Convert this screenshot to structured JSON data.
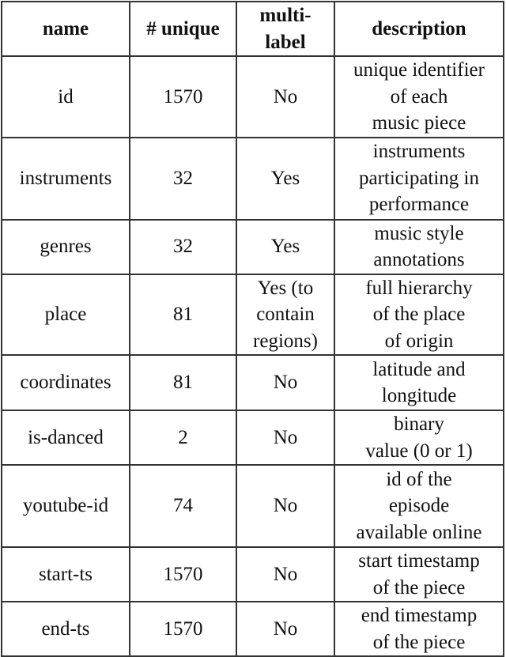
{
  "table": {
    "headers": [
      {
        "lines": [
          "name"
        ]
      },
      {
        "lines": [
          "# unique"
        ]
      },
      {
        "lines": [
          "multi-",
          "label"
        ]
      },
      {
        "lines": [
          "description"
        ]
      }
    ],
    "rows": [
      {
        "key": "id",
        "name": "id",
        "unique": "1570",
        "multilabel": [
          "No"
        ],
        "description": [
          "unique identifier",
          "of each",
          "music piece"
        ]
      },
      {
        "key": "instruments",
        "name": "instruments",
        "unique": "32",
        "multilabel": [
          "Yes"
        ],
        "description": [
          "instruments",
          "participating in",
          "performance"
        ]
      },
      {
        "key": "genres",
        "name": "genres",
        "unique": "32",
        "multilabel": [
          "Yes"
        ],
        "description": [
          "music style",
          "annotations"
        ]
      },
      {
        "key": "place",
        "name": "place",
        "unique": "81",
        "multilabel": [
          "Yes (to",
          "contain",
          "regions)"
        ],
        "description": [
          "full hierarchy",
          "of the place",
          "of origin"
        ]
      },
      {
        "key": "coordinates",
        "name": "coordinates",
        "unique": "81",
        "multilabel": [
          "No"
        ],
        "description": [
          "latitude and",
          "longitude"
        ]
      },
      {
        "key": "is-danced",
        "name": "is-danced",
        "unique": "2",
        "multilabel": [
          "No"
        ],
        "description": [
          "binary",
          "value (0 or 1)"
        ]
      },
      {
        "key": "youtube-id",
        "name": "youtube-id",
        "unique": "74",
        "multilabel": [
          "No"
        ],
        "description": [
          "id of the",
          "episode",
          "available online"
        ]
      },
      {
        "key": "start-ts",
        "name": "start-ts",
        "unique": "1570",
        "multilabel": [
          "No"
        ],
        "description": [
          "start timestamp",
          "of the piece"
        ]
      },
      {
        "key": "end-ts",
        "name": "end-ts",
        "unique": "1570",
        "multilabel": [
          "No"
        ],
        "description": [
          "end timestamp",
          "of the piece"
        ]
      }
    ]
  }
}
